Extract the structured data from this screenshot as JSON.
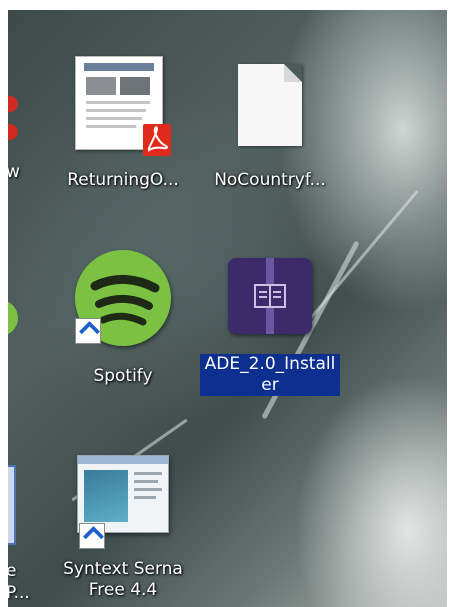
{
  "icons": [
    {
      "label": "ReturningO..."
    },
    {
      "label": "NoCountryf..."
    },
    {
      "label": "Spotify"
    },
    {
      "label": "ADE_2.0_Installer"
    },
    {
      "label": "Syntext Serna Free 4.4"
    }
  ],
  "partial_left": {
    "top_fragment": "w",
    "bottom_fragment_1": "e",
    "bottom_fragment_2": "P..."
  },
  "colors": {
    "selection": "#0d2f8f",
    "spotify_green": "#7cc242",
    "ade_purple": "#3c2a6b",
    "pdf_red": "#e02b1c"
  }
}
